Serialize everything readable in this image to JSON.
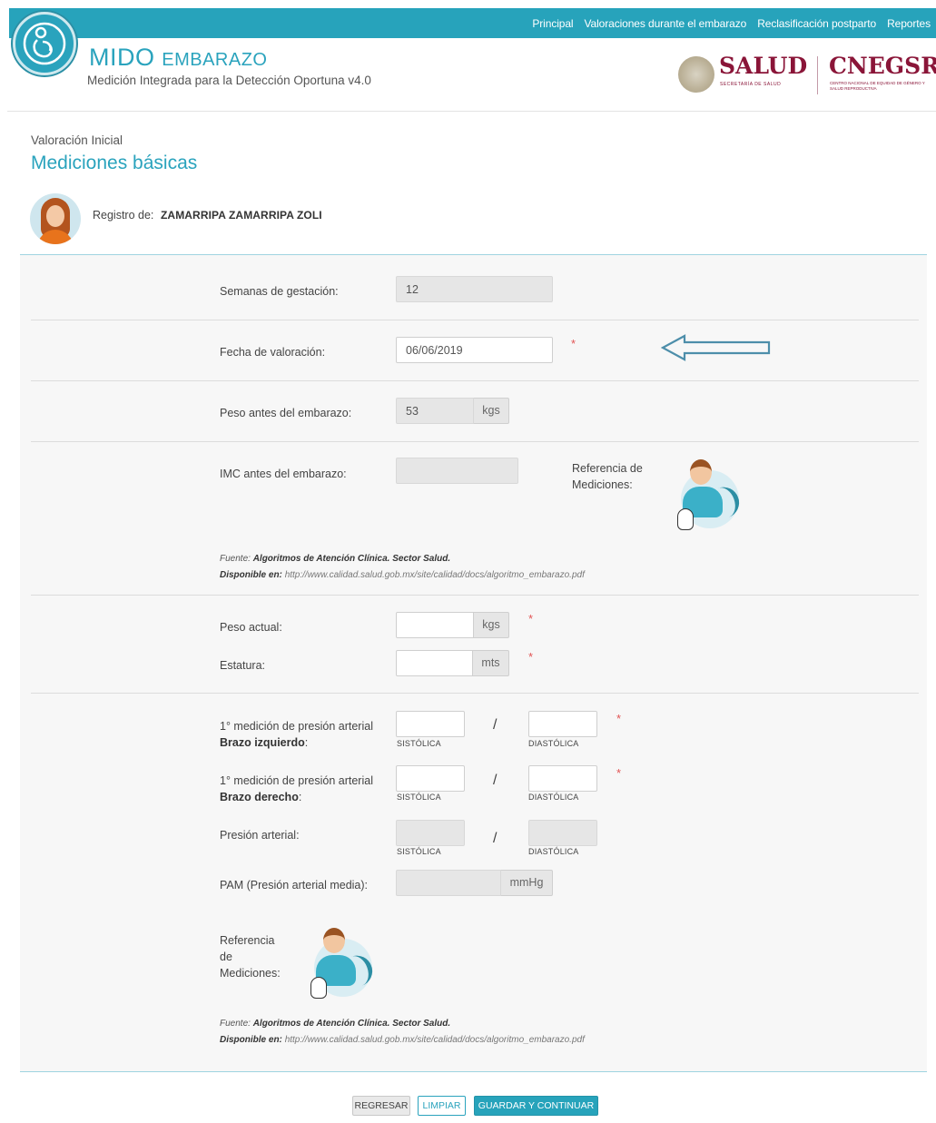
{
  "nav": {
    "items": [
      "Principal",
      "Valoraciones durante el embarazo",
      "Reclasificación postparto",
      "Reportes"
    ]
  },
  "header": {
    "title_main": "MIDO",
    "title_sub": "EMBARAZO",
    "subtitle": "Medición Integrada para la Detección Oportuna v4.0",
    "logo_salud": "SALUD",
    "logo_salud_sub": "SECRETARÍA DE SALUD",
    "logo_cnegsr": "CNEGSR",
    "logo_cnegsr_sub": "CENTRO NACIONAL DE EQUIDAD DE GÉNERO Y SALUD REPRODUCTIVA"
  },
  "page": {
    "breadcrumb": "Valoración Inicial",
    "title": "Mediciones básicas"
  },
  "patient": {
    "label": "Registro de:",
    "name": "ZAMARRIPA ZAMARRIPA ZOLI"
  },
  "form": {
    "gestation_label": "Semanas de gestación:",
    "gestation_value": "12",
    "date_label": "Fecha de valoración:",
    "date_value": "06/06/2019",
    "prev_weight_label": "Peso antes del embarazo:",
    "prev_weight_value": "53",
    "unit_kgs": "kgs",
    "unit_mts": "mts",
    "unit_mmhg": "mmHg",
    "imc_label": "IMC antes del embarazo:",
    "imc_value": "",
    "ref_label_1": "Referencia de Mediciones:",
    "ref_label_2": "Referencia de Mediciones:",
    "current_weight_label": "Peso actual:",
    "current_weight_value": "",
    "height_label": "Estatura:",
    "height_value": "",
    "bp_left_label_a": "1° medición de presión arterial ",
    "bp_left_label_b": "Brazo izquierdo",
    "bp_right_label_a": "1° medición de presión arterial ",
    "bp_right_label_b": "Brazo derecho",
    "bp_label": "Presión arterial:",
    "pam_label": "PAM (Presión arterial media):",
    "systolic": "SISTÓLICA",
    "diastolic": "DIASTÓLICA",
    "slash": "/",
    "required_mark": "*",
    "source_prefix": "Fuente:",
    "source_text": "Algoritmos de Atención Clínica. Sector Salud.",
    "available_prefix": "Disponible en:",
    "available_url": "http://www.calidad.salud.gob.mx/site/calidad/docs/algoritmo_embarazo.pdf"
  },
  "buttons": {
    "back": "REGRESAR",
    "clear": "LIMPIAR",
    "save": "GUARDAR Y CONTINUAR"
  }
}
